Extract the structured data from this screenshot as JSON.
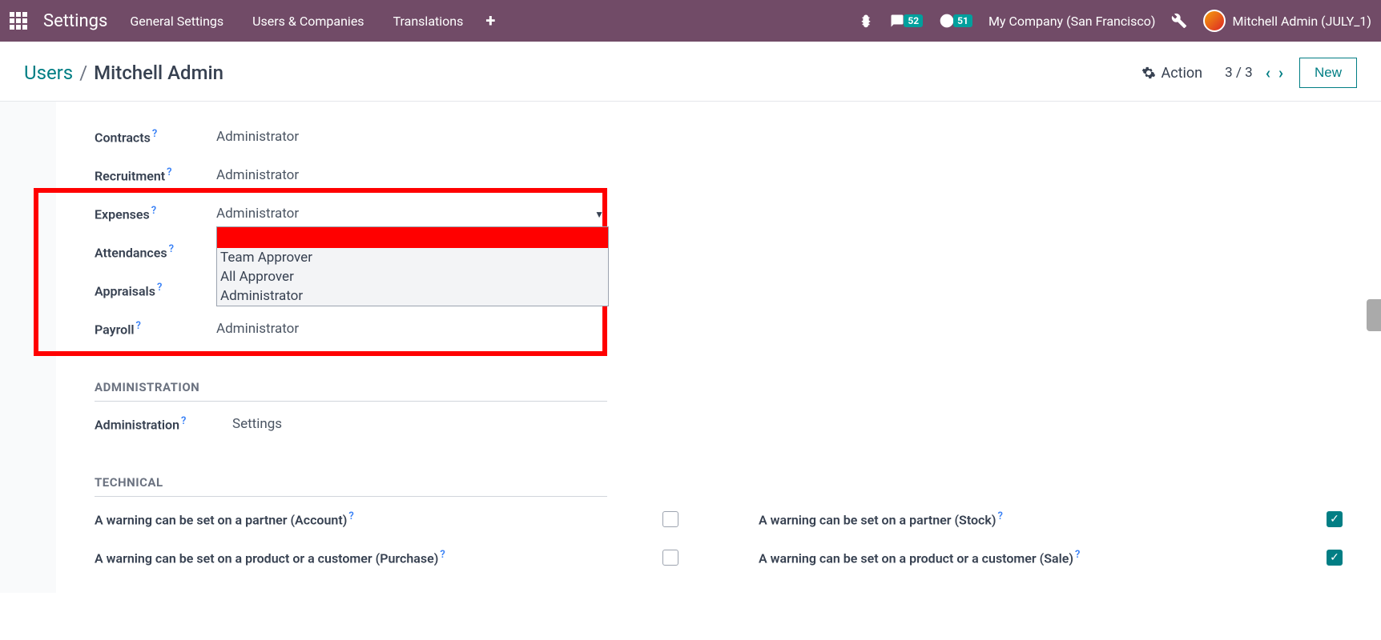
{
  "topbar": {
    "app_title": "Settings",
    "menu": [
      "General Settings",
      "Users & Companies",
      "Translations"
    ],
    "messaging_count": "52",
    "activity_count": "51",
    "company": "My Company (San Francisco)",
    "user": "Mitchell Admin (JULY_1)"
  },
  "controlbar": {
    "breadcrumb_root": "Users",
    "breadcrumb_current": "Mitchell Admin",
    "action_label": "Action",
    "pager": "3 / 3",
    "new_label": "New"
  },
  "form": {
    "rows": [
      {
        "label": "Contracts",
        "value": "Administrator"
      },
      {
        "label": "Recruitment",
        "value": "Administrator"
      },
      {
        "label": "Expenses",
        "value": "Administrator",
        "is_dropdown": true
      },
      {
        "label": "Attendances",
        "value": ""
      },
      {
        "label": "Appraisals",
        "value": ""
      },
      {
        "label": "Payroll",
        "value": "Administrator"
      }
    ],
    "dropdown_options": [
      "",
      "Team Approver",
      "All Approver",
      "Administrator"
    ]
  },
  "sections": {
    "administration": {
      "title": "ADMINISTRATION",
      "rows": [
        {
          "label": "Administration",
          "value": "Settings"
        }
      ]
    },
    "technical": {
      "title": "TECHNICAL",
      "rows": [
        {
          "label": "A warning can be set on a partner (Account)",
          "checked": false
        },
        {
          "label": "A warning can be set on a partner (Stock)",
          "checked": true
        },
        {
          "label": "A warning can be set on a product or a customer (Purchase)",
          "checked": false
        },
        {
          "label": "A warning can be set on a product or a customer (Sale)",
          "checked": true
        }
      ]
    }
  }
}
